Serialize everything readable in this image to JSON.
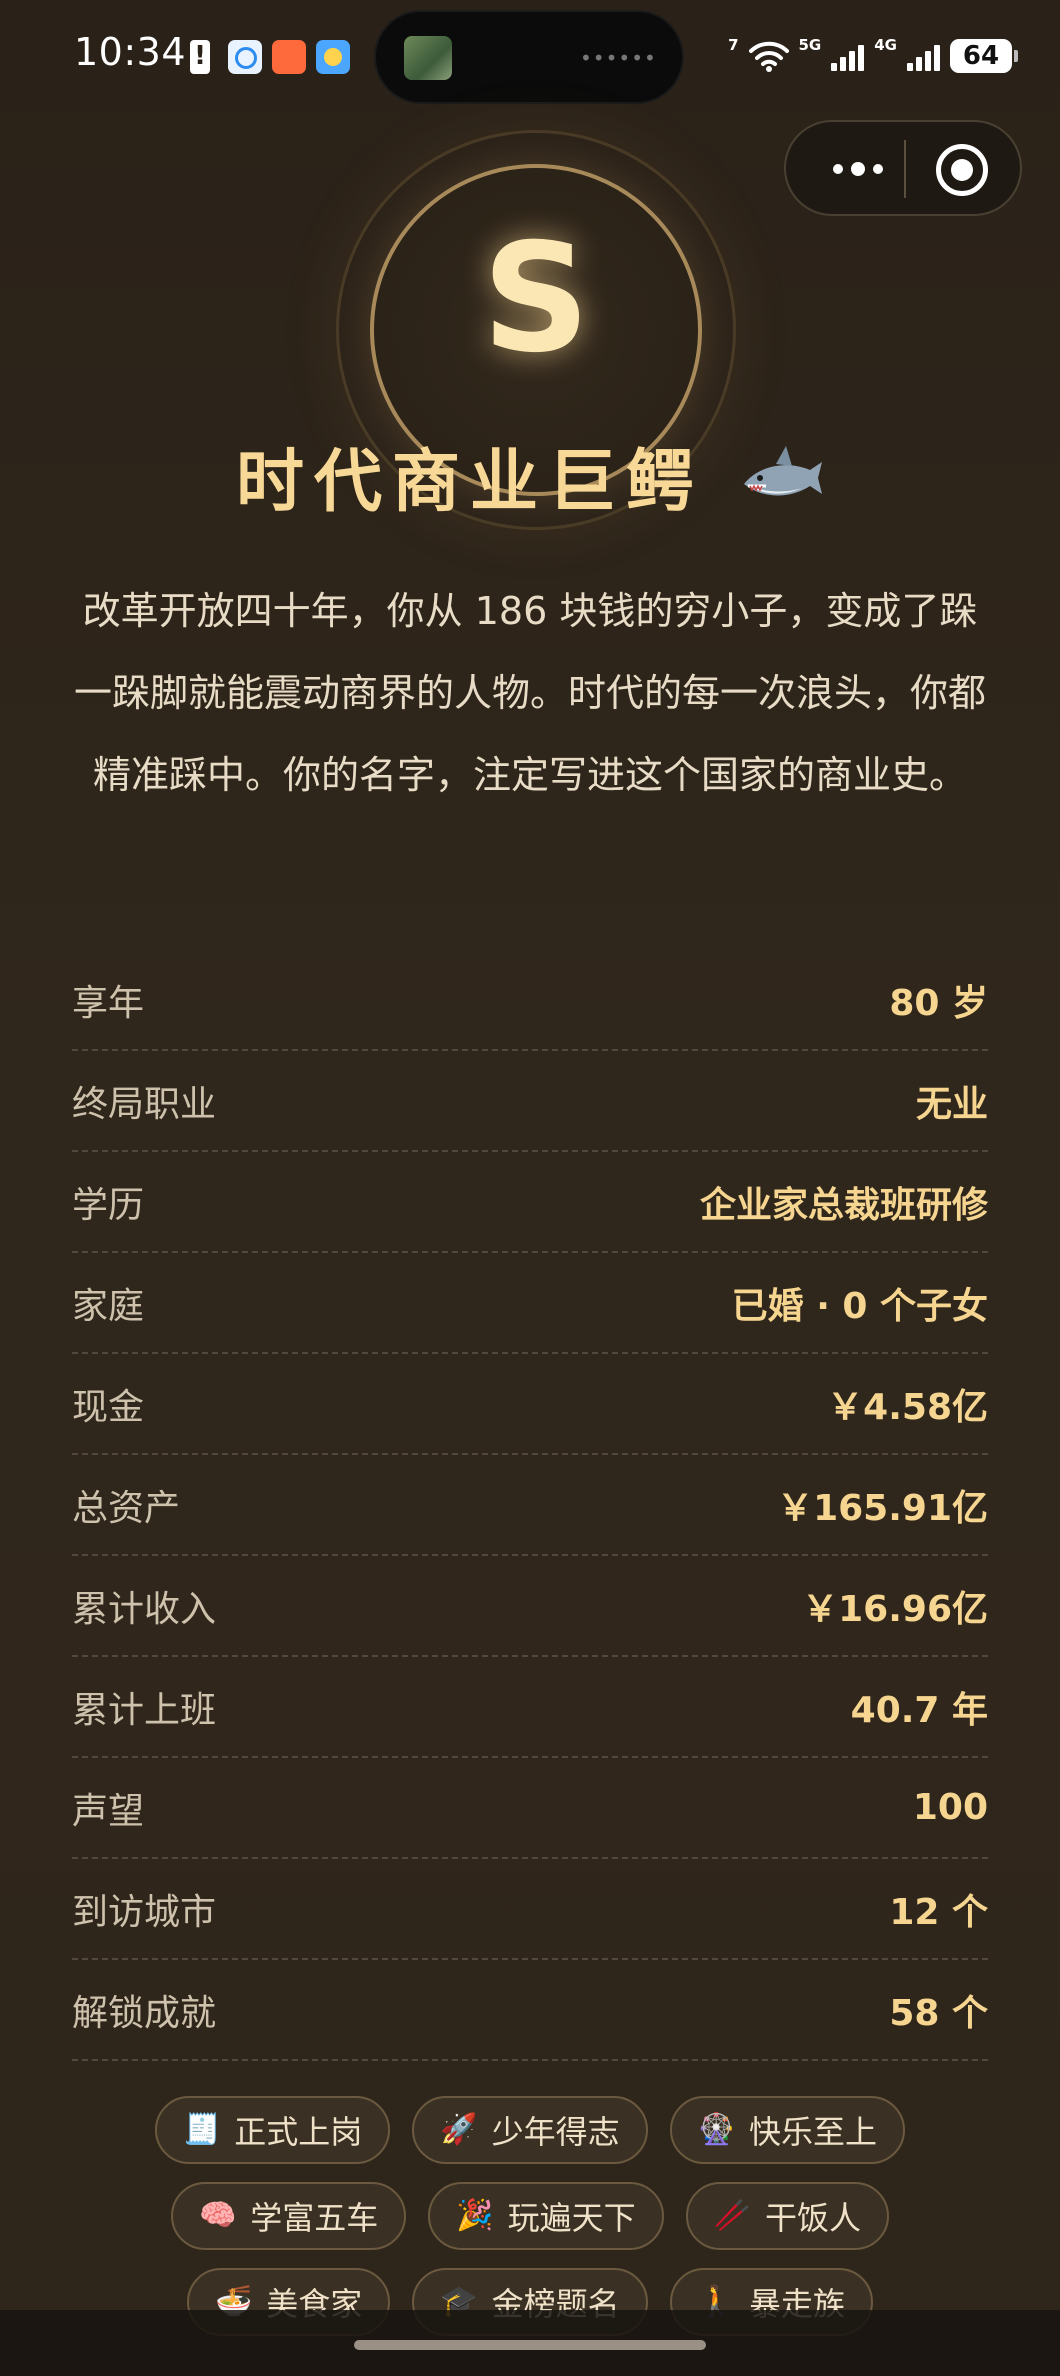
{
  "status_bar": {
    "time": "10:34",
    "wifi_label": "7",
    "signal1_label": "5G",
    "signal2_label": "4G",
    "battery": "64"
  },
  "capsule": {
    "more_icon": "more-dots-icon",
    "close_icon": "target-close-icon"
  },
  "hero": {
    "grade": "S",
    "title": "时代商业巨鳄",
    "emoji_icon": "shark-icon"
  },
  "description": "改革开放四十年，你从 186 块钱的穷小子，变成了跺一跺脚就能震动商界的人物。时代的每一次浪头，你都精准踩中。你的名字，注定写进这个国家的商业史。",
  "stats": [
    {
      "label": "享年",
      "value": "80 岁"
    },
    {
      "label": "终局职业",
      "value": "无业"
    },
    {
      "label": "学历",
      "value": "企业家总裁班研修"
    },
    {
      "label": "家庭",
      "value": "已婚 · 0 个子女"
    },
    {
      "label": "现金",
      "value": "￥4.58亿"
    },
    {
      "label": "总资产",
      "value": "￥165.91亿"
    },
    {
      "label": "累计收入",
      "value": "￥16.96亿"
    },
    {
      "label": "累计上班",
      "value": "40.7 年"
    },
    {
      "label": "声望",
      "value": "100"
    },
    {
      "label": "到访城市",
      "value": "12 个"
    },
    {
      "label": "解锁成就",
      "value": "58 个"
    }
  ],
  "achievements": [
    {
      "icon": "🧾",
      "label": "正式上岗"
    },
    {
      "icon": "🚀",
      "label": "少年得志"
    },
    {
      "icon": "🎡",
      "label": "快乐至上"
    },
    {
      "icon": "🧠",
      "label": "学富五车"
    },
    {
      "icon": "🎉",
      "label": "玩遍天下"
    },
    {
      "icon": "🥢",
      "label": "干饭人"
    },
    {
      "icon": "🍜",
      "label": "美食家"
    },
    {
      "icon": "🎓",
      "label": "金榜题名"
    },
    {
      "icon": "🚶",
      "label": "暴走族"
    }
  ],
  "colors": {
    "background": "#2d2419",
    "accent_gold": "#f6d590",
    "title_gold": "#f7d896",
    "text": "#e8dcc6"
  }
}
